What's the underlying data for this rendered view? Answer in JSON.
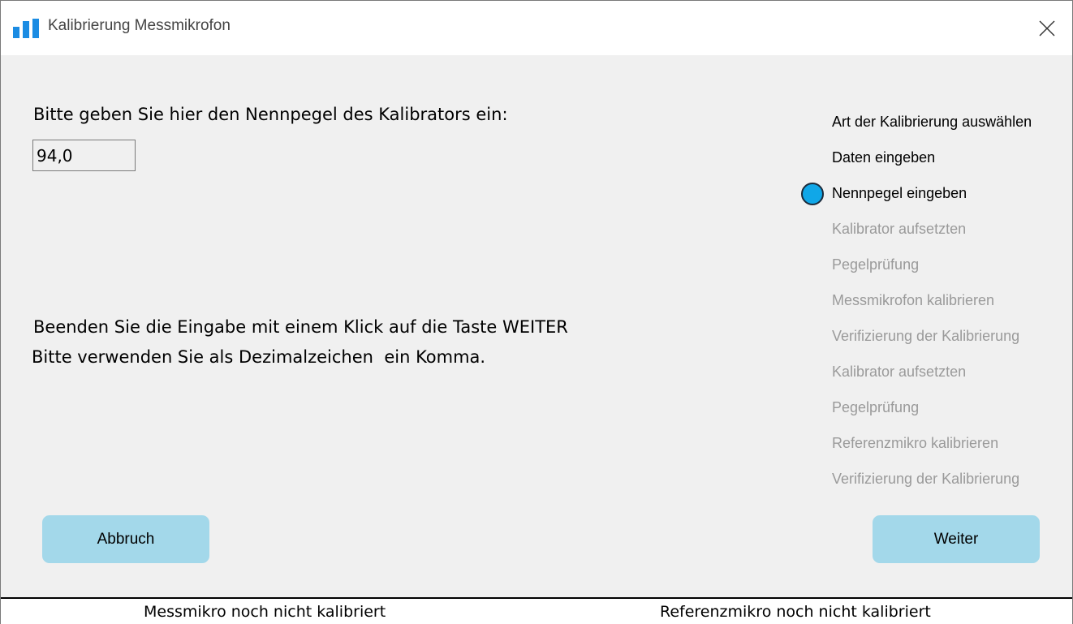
{
  "window": {
    "title": "Kalibrierung Messmikrofon",
    "accent_color": "#1b8ce3"
  },
  "form": {
    "prompt": "Bitte geben Sie hier den Nennpegel des Kalibrators ein:",
    "level_value": "94,0",
    "hint_finish": "Beenden Sie die Eingabe mit einem Klick auf die Taste WEITER",
    "hint_decimal": "Bitte verwenden Sie als Dezimalzeichen  ein Komma."
  },
  "steps": [
    {
      "label": "Art der Kalibrierung auswählen",
      "state": "done"
    },
    {
      "label": "Daten eingeben",
      "state": "done"
    },
    {
      "label": "Nennpegel eingeben",
      "state": "active"
    },
    {
      "label": "Kalibrator aufsetzten",
      "state": "pending"
    },
    {
      "label": "Pegelprüfung",
      "state": "pending"
    },
    {
      "label": "Messmikrofon kalibrieren",
      "state": "pending"
    },
    {
      "label": "Verifizierung der Kalibrierung",
      "state": "pending"
    },
    {
      "label": "Kalibrator aufsetzten",
      "state": "pending"
    },
    {
      "label": "Pegelprüfung",
      "state": "pending"
    },
    {
      "label": "Referenzmikro kalibrieren",
      "state": "pending"
    },
    {
      "label": "Verifizierung der Kalibrierung",
      "state": "pending"
    }
  ],
  "step_dot_color": "#10a7e8",
  "buttons": {
    "cancel_label": "Abbruch",
    "next_label": "Weiter",
    "color": "#a3d8ea"
  },
  "status": {
    "left": "Messmikro noch nicht kalibriert",
    "right": "Referenzmikro noch nicht kalibriert"
  }
}
